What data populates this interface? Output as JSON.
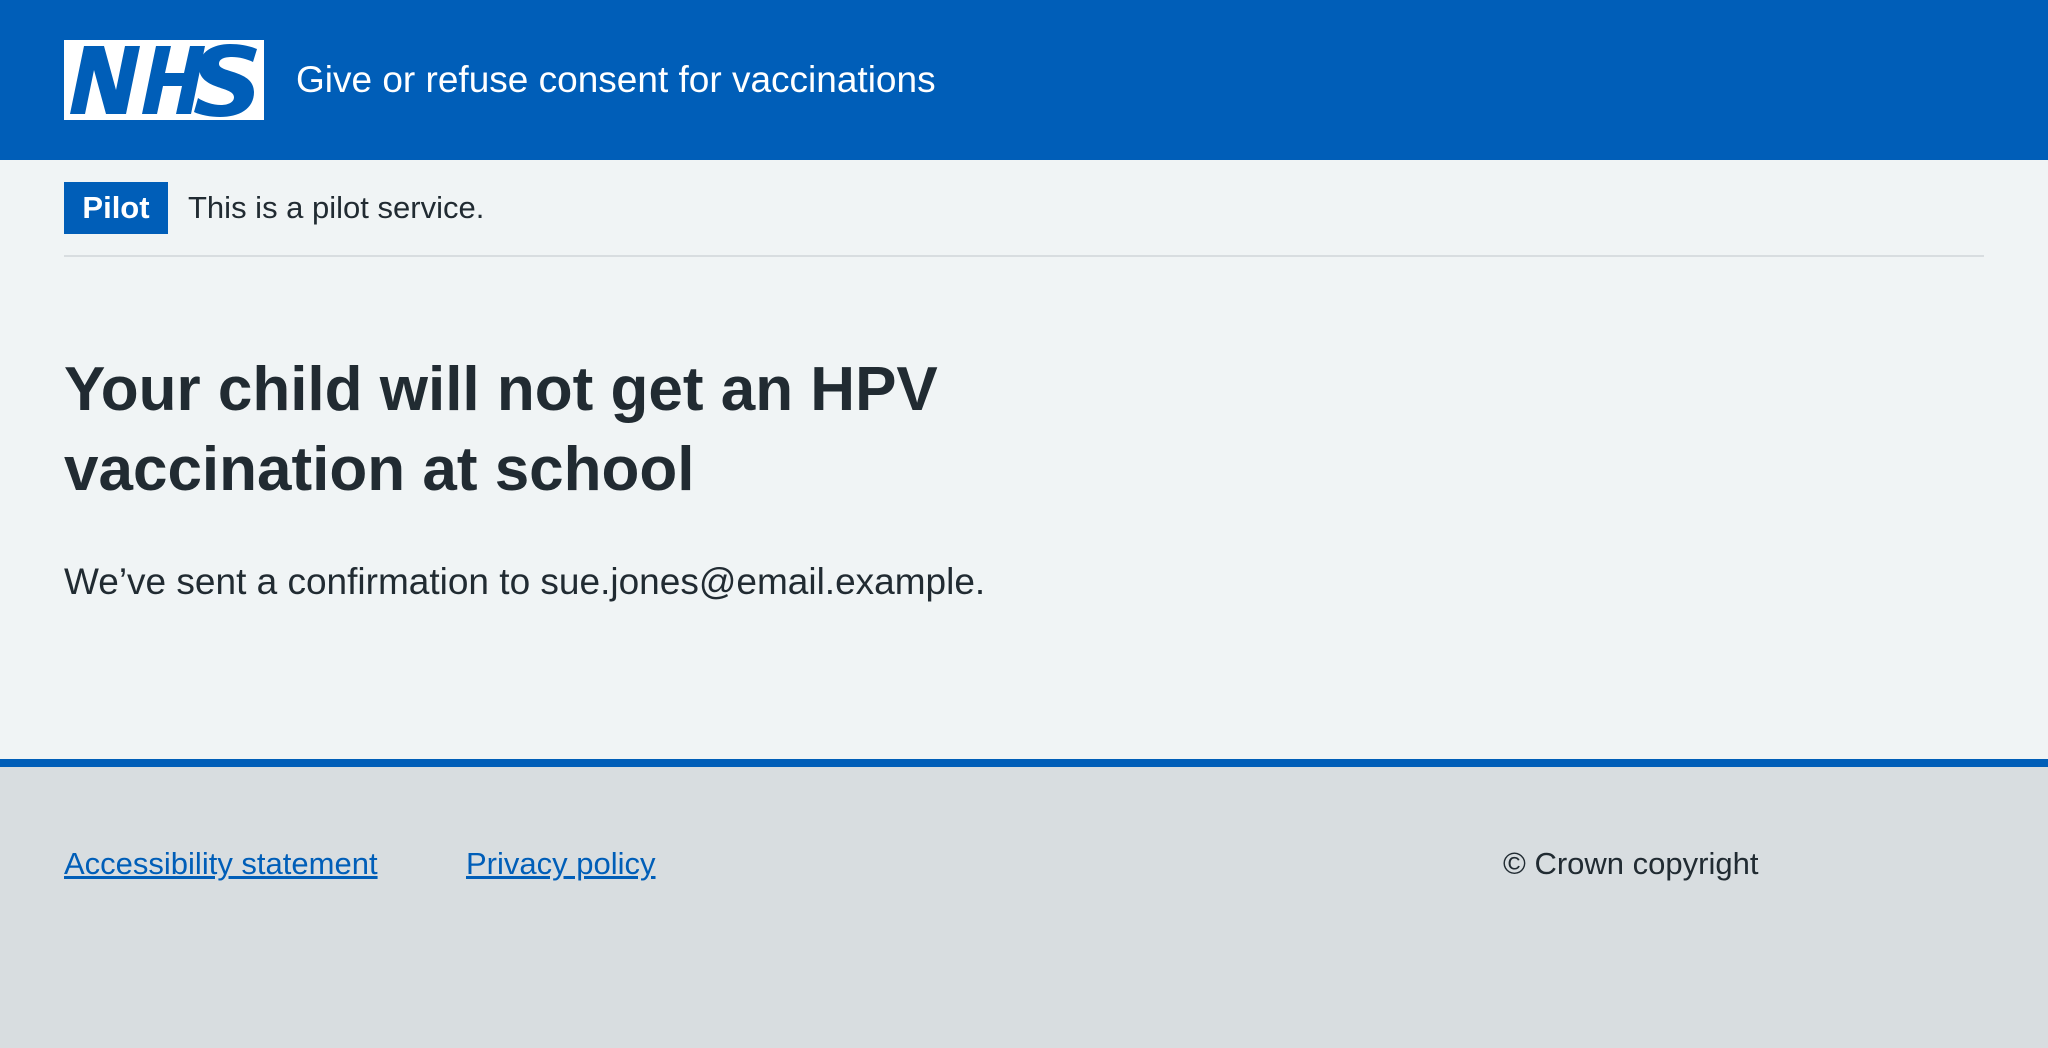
{
  "header": {
    "logo_text": "NHS",
    "service_name": "Give or refuse consent for vaccinations",
    "brand_color": "#005eb8"
  },
  "phase_banner": {
    "tag": "Pilot",
    "text": "This is a pilot service."
  },
  "main": {
    "title": "Your child will not get an HPV vaccination at school",
    "confirmation": "We’ve sent a confirmation to sue.jones@email.example."
  },
  "footer": {
    "links": [
      {
        "label": "Accessibility statement"
      },
      {
        "label": "Privacy policy"
      }
    ],
    "copyright": "© Crown copyright"
  }
}
